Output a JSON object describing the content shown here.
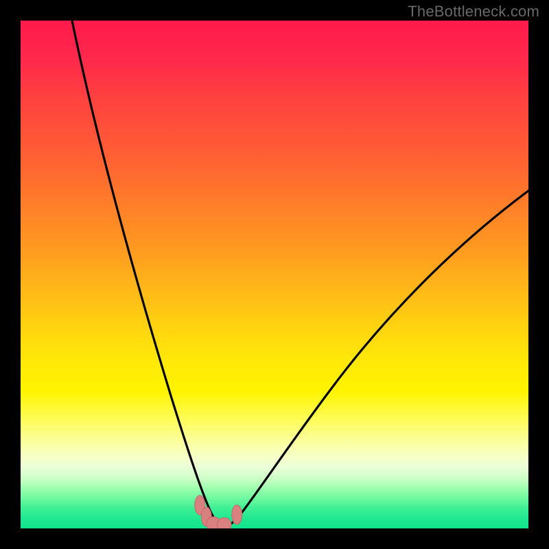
{
  "watermark": "TheBottleneck.com",
  "colors": {
    "frame": "#000000",
    "curve": "#000000",
    "marker_fill": "#d98080",
    "marker_stroke": "#c06a6a"
  },
  "chart_data": {
    "type": "line",
    "title": "",
    "xlabel": "",
    "ylabel": "",
    "xlim": [
      0,
      100
    ],
    "ylim": [
      0,
      100
    ],
    "grid": false,
    "legend": false,
    "series": [
      {
        "name": "left-branch",
        "x": [
          10.1,
          14,
          18,
          22,
          26,
          30,
          32,
          34,
          35.5,
          37,
          38,
          38.8
        ],
        "y": [
          100,
          79,
          60,
          43,
          28,
          15.5,
          10.5,
          6.5,
          4,
          2,
          1,
          0.3
        ]
      },
      {
        "name": "right-branch",
        "x": [
          41.2,
          42.5,
          44,
          47,
          51,
          56,
          62,
          70,
          80,
          90,
          100
        ],
        "y": [
          0.3,
          2,
          4.5,
          9,
          15,
          22,
          30,
          39,
          49.5,
          58.5,
          66.5
        ]
      }
    ],
    "markers": [
      {
        "x": 35.3,
        "y": 4.6,
        "rx": 1.0,
        "ry": 1.9
      },
      {
        "x": 36.6,
        "y": 2.3,
        "rx": 1.0,
        "ry": 1.9
      },
      {
        "x": 38.0,
        "y": 0.9,
        "rx": 1.4,
        "ry": 1.4
      },
      {
        "x": 40.1,
        "y": 0.7,
        "rx": 1.4,
        "ry": 1.4
      },
      {
        "x": 42.6,
        "y": 2.7,
        "rx": 1.0,
        "ry": 1.9
      }
    ],
    "background_gradient": {
      "top": "#ff1a4d",
      "middle": "#ffe808",
      "bottom": "#10e48c"
    }
  }
}
